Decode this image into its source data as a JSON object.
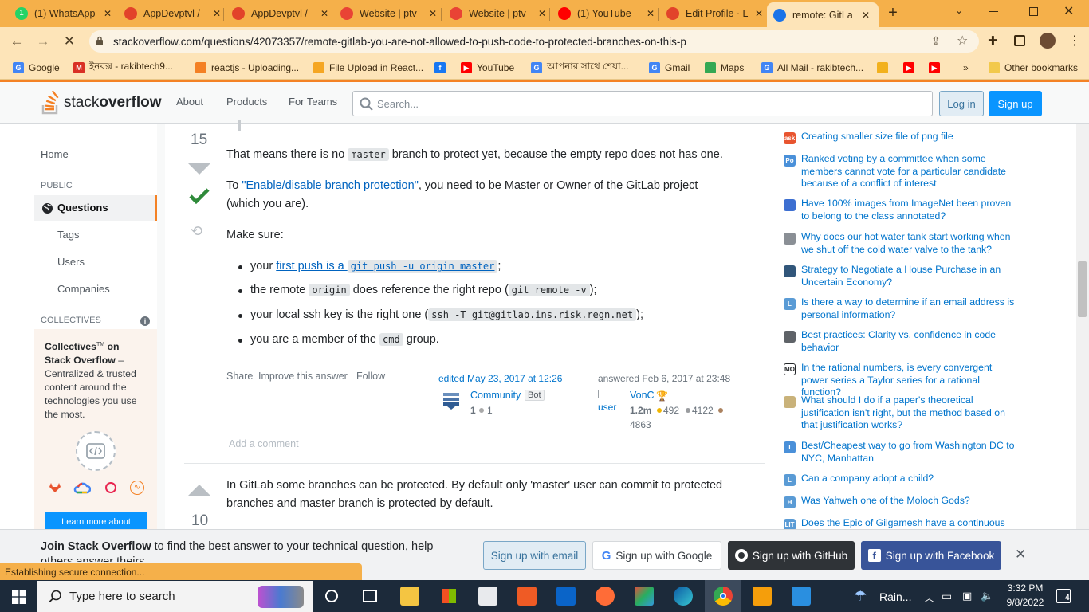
{
  "browser": {
    "tabs": [
      {
        "title": "(1) WhatsApp",
        "color": "#25d366",
        "glyph": "1"
      },
      {
        "title": "AppDevptvl /",
        "color": "#e2432a",
        "glyph": ""
      },
      {
        "title": "AppDevptvl /",
        "color": "#e2432a",
        "glyph": ""
      },
      {
        "title": "Website | ptv",
        "color": "#e94335",
        "glyph": ""
      },
      {
        "title": "Website | ptv",
        "color": "#e94335",
        "glyph": ""
      },
      {
        "title": "(1) YouTube",
        "color": "#ff0000",
        "glyph": ""
      },
      {
        "title": "Edit Profile · L",
        "color": "#e2432a",
        "glyph": ""
      },
      {
        "title": "remote: GitLa",
        "color": "#1a73e8",
        "glyph": ""
      }
    ],
    "url": "stackoverflow.com/questions/42073357/remote-gitlab-you-are-not-allowed-to-push-code-to-protected-branches-on-this-p",
    "bookmarks": [
      {
        "label": "Google",
        "color": "#4285f4",
        "glyph": "G"
      },
      {
        "label": "ইনবক্স - rakibtech9...",
        "color": "#d93025",
        "glyph": "M"
      },
      {
        "label": "reactjs - Uploading...",
        "color": "#f48024",
        "glyph": ""
      },
      {
        "label": "File Upload in React...",
        "color": "#f5a623",
        "glyph": ""
      },
      {
        "label": "",
        "color": "#1877f2",
        "glyph": "f"
      },
      {
        "label": "YouTube",
        "color": "#ff0000",
        "glyph": "▶"
      },
      {
        "label": "আপনার সাথে শেয়া...",
        "color": "#4285f4",
        "glyph": "G"
      },
      {
        "label": "Gmail",
        "color": "#4285f4",
        "glyph": "G"
      },
      {
        "label": "Maps",
        "color": "#34a853",
        "glyph": ""
      },
      {
        "label": "All Mail - rakibtech...",
        "color": "#4285f4",
        "glyph": "G"
      },
      {
        "label": "",
        "color": "#f2b11d",
        "glyph": ""
      },
      {
        "label": "",
        "color": "#ff0000",
        "glyph": "▶"
      },
      {
        "label": "",
        "color": "#ff0000",
        "glyph": "▶"
      }
    ],
    "more_bookmarks": "»",
    "other_bookmarks": "Other bookmarks",
    "status": "Establishing secure connection..."
  },
  "header": {
    "logo_a": "stack",
    "logo_b": "overflow",
    "nav": [
      "About",
      "Products",
      "For Teams"
    ],
    "search_placeholder": "Search...",
    "login": "Log in",
    "signup": "Sign up"
  },
  "sidebar": {
    "home": "Home",
    "public": "PUBLIC",
    "questions": "Questions",
    "tags": "Tags",
    "users": "Users",
    "companies": "Companies",
    "collectives": "COLLECTIVES",
    "collectives_title_a": "Collectives",
    "collectives_title_tm": "TM",
    "collectives_title_b": " on Stack Overflow",
    "collectives_desc": " – Centralized & trusted content around the technologies you use the most.",
    "learn_more": "Learn more about"
  },
  "answer1": {
    "votes": "15",
    "p1_pre": "That means there is no ",
    "p1_code": "master",
    "p1_post": " branch to protect yet, because the empty repo does not has one.",
    "p2_pre": "To ",
    "p2_link": "\"Enable/disable branch protection\"",
    "p2_post": ", you need to be Master or Owner of the GitLab project",
    "p2_line2": "(which you are).",
    "make_sure": "Make sure:",
    "b1_pre": "your ",
    "b1_link": "first push is a ",
    "b1_code": "git push -u origin master",
    "b1_post": ";",
    "b2_pre": "the remote ",
    "b2_code": "origin",
    "b2_mid": " does reference the right repo (",
    "b2_code2": "git remote -v",
    "b2_post": ");",
    "b3_pre": "your local ssh key is the right one (",
    "b3_code": "ssh -T git@gitlab.ins.risk.regn.net",
    "b3_post": ");",
    "b4_pre": "you are a member of the ",
    "b4_code": "cmd",
    "b4_post": " group.",
    "share": "Share",
    "improve": "Improve this answer",
    "follow": "Follow",
    "edited": "edited May 23, 2017 at 12:26",
    "editor": "Community",
    "editor_badge": "Bot",
    "editor_rep": "1",
    "editor_bronze": "1",
    "answered": "answered Feb 6, 2017 at 23:48",
    "author": "VonC",
    "author_rep": "1.2m",
    "gold": "492",
    "silver": "4122",
    "bronze": "4863",
    "avatar_alt": "user",
    "add_comment": "Add a comment"
  },
  "answer2": {
    "votes": "10",
    "line1": "In GitLab some branches can be protected. By default only 'master' user can commit to protected",
    "line2": "branches and master branch is protected by default."
  },
  "hot_questions": [
    {
      "text": "Creating smaller size file of png file",
      "color": "#e8542f",
      "glyph": "ask"
    },
    {
      "text": "Ranked voting by a committee when some members cannot vote for a particular candidate because of a conflict of interest",
      "color": "#4a90d9",
      "glyph": "Po"
    },
    {
      "text": "Have 100% images from ImageNet been proven to belong to the class annotated?",
      "color": "#3d6fd1",
      "glyph": ""
    },
    {
      "text": "Why does our hot water tank start working when we shut off the cold water valve to the tank?",
      "color": "#8a8f95",
      "glyph": ""
    },
    {
      "text": "Strategy to Negotiate a House Purchase in an Uncertain Economy?",
      "color": "#31567a",
      "glyph": ""
    },
    {
      "text": "Is there a way to determine if an email address is personal information?",
      "color": "#5a9bd5",
      "glyph": "L"
    },
    {
      "text": "Best practices: Clarity vs. confidence in code behavior",
      "color": "#5f6368",
      "glyph": ""
    },
    {
      "text": "In the rational numbers, is every convergent power series a Taylor series for a rational function?",
      "color": "#ffffff",
      "glyph": "MO"
    },
    {
      "text": "What should I do if a paper's theoretical justification isn't right, but the method based on that justification works?",
      "color": "#c9b27a",
      "glyph": ""
    },
    {
      "text": "Best/Cheapest way to go from Washington DC to NYC, Manhattan",
      "color": "#4a90d9",
      "glyph": "T"
    },
    {
      "text": "Can a company adopt a child?",
      "color": "#5a9bd5",
      "glyph": "L"
    },
    {
      "text": "Was Yahweh one of the Moloch Gods?",
      "color": "#5a9bd5",
      "glyph": "H"
    },
    {
      "text": "Does the Epic of Gilgamesh have a continuous",
      "color": "#5a9bd5",
      "glyph": "LIT"
    }
  ],
  "join": {
    "bold": "Join Stack Overflow",
    "rest": " to find the best answer to your technical question, help",
    "line2": "others answer theirs.",
    "email": "Sign up with email",
    "google": "Sign up with Google",
    "github": "Sign up with GitHub",
    "facebook": "Sign up with Facebook"
  },
  "taskbar": {
    "search": "Type here to search",
    "weather": "Rain...",
    "time": "3:32 PM",
    "date": "9/8/2022",
    "notifications": "4"
  }
}
